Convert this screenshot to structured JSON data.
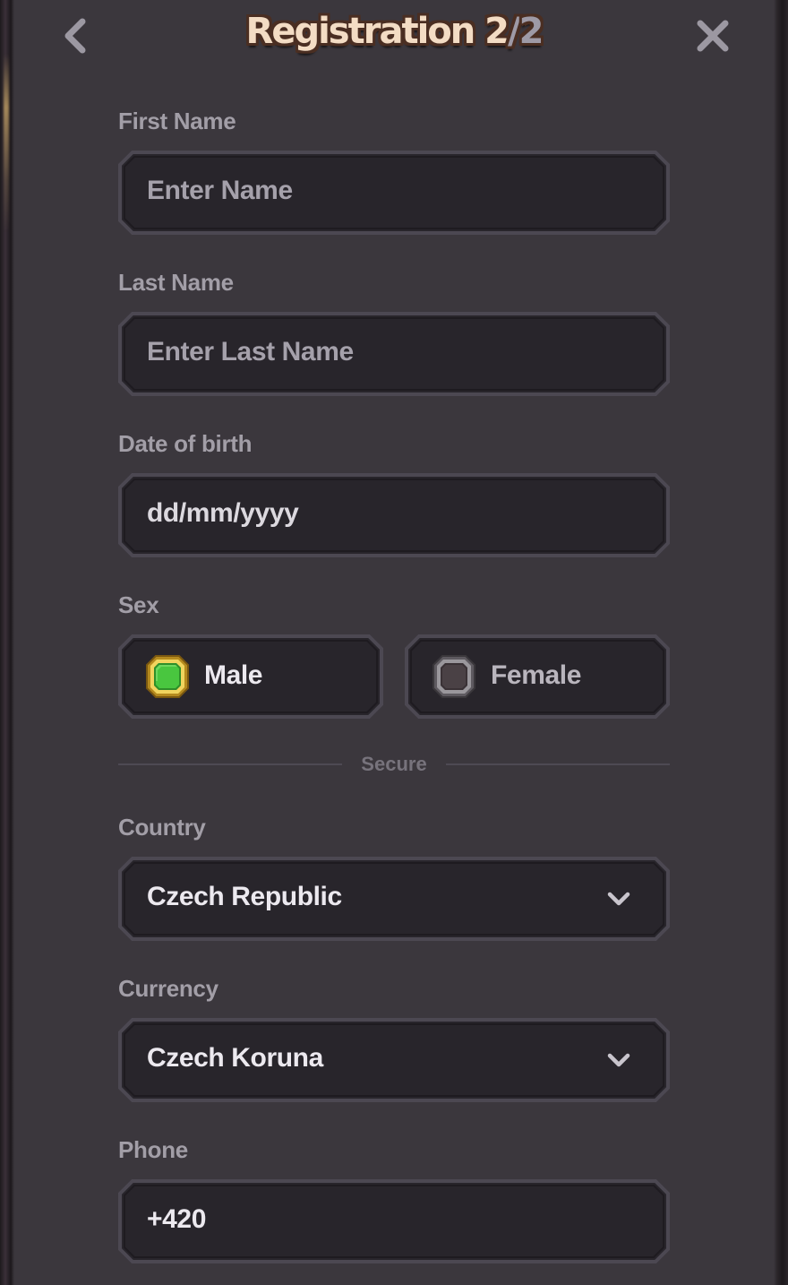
{
  "header": {
    "title_main": "Registration 2",
    "title_sep": "/",
    "title_total": "2",
    "back_icon": "chevron-left-icon",
    "close_icon": "close-icon"
  },
  "form": {
    "first_name": {
      "label": "First Name",
      "placeholder": "Enter Name"
    },
    "last_name": {
      "label": "Last Name",
      "placeholder": "Enter Last Name"
    },
    "dob": {
      "label": "Date of birth",
      "placeholder": "dd/mm/yyyy"
    },
    "sex": {
      "label": "Sex",
      "options": [
        {
          "label": "Male",
          "selected": true
        },
        {
          "label": "Female",
          "selected": false
        }
      ]
    },
    "divider_text": "Secure",
    "country": {
      "label": "Country",
      "value": "Czech Republic"
    },
    "currency": {
      "label": "Currency",
      "value": "Czech Koruna"
    },
    "phone": {
      "label": "Phone",
      "value": "+420"
    }
  },
  "colors": {
    "background": "#3b373d",
    "field_bg": "#28252b",
    "field_border": "#4c4852",
    "label": "#a29ea7",
    "title_fill": "#f3dcc4",
    "title_outline": "#4a2e22",
    "gem_selected": "#3fbf3a",
    "gem_frame_selected": "#e3c24a"
  }
}
